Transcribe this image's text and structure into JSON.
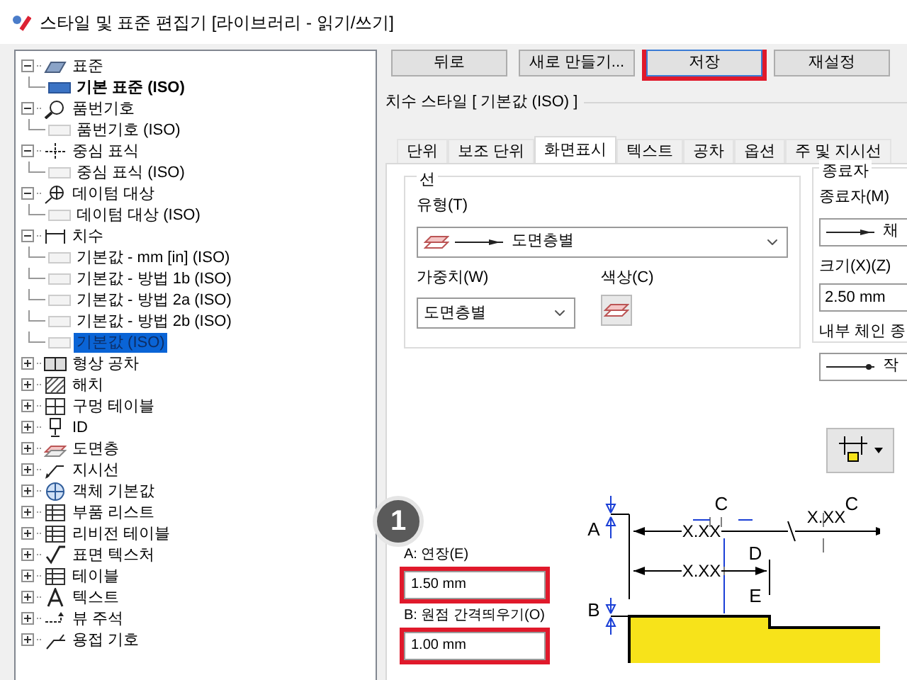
{
  "window": {
    "title": "스타일 및 표준 편집기 [라이브러리 - 읽기/쓰기]"
  },
  "tree": [
    {
      "label": "표준",
      "expanded": true,
      "children": [
        {
          "label": "기본 표준 (ISO)",
          "active": true,
          "selected": false
        }
      ]
    },
    {
      "label": "품번기호",
      "expanded": true,
      "children": [
        {
          "label": "품번기호 (ISO)",
          "active": false,
          "selected": false
        }
      ]
    },
    {
      "label": "중심 표식",
      "expanded": true,
      "children": [
        {
          "label": "중심 표식 (ISO)",
          "active": false,
          "selected": false
        }
      ]
    },
    {
      "label": "데이텀 대상",
      "expanded": true,
      "children": [
        {
          "label": "데이텀 대상 (ISO)",
          "active": false,
          "selected": false
        }
      ]
    },
    {
      "label": "치수",
      "expanded": true,
      "children": [
        {
          "label": "기본값 - mm [in] (ISO)",
          "active": false,
          "selected": false
        },
        {
          "label": "기본값 - 방법 1b (ISO)",
          "active": false,
          "selected": false
        },
        {
          "label": "기본값 - 방법 2a (ISO)",
          "active": false,
          "selected": false
        },
        {
          "label": "기본값 - 방법 2b (ISO)",
          "active": false,
          "selected": false
        },
        {
          "label": "기본값 (ISO)",
          "active": false,
          "selected": true
        }
      ]
    },
    {
      "label": "형상 공차",
      "expanded": false
    },
    {
      "label": "해치",
      "expanded": false
    },
    {
      "label": "구멍 테이블",
      "expanded": false
    },
    {
      "label": "ID",
      "expanded": false
    },
    {
      "label": "도면층",
      "expanded": false
    },
    {
      "label": "지시선",
      "expanded": false
    },
    {
      "label": "객체 기본값",
      "expanded": false
    },
    {
      "label": "부품 리스트",
      "expanded": false
    },
    {
      "label": "리비전 테이블",
      "expanded": false
    },
    {
      "label": "표면 텍스처",
      "expanded": false
    },
    {
      "label": "테이블",
      "expanded": false
    },
    {
      "label": "텍스트",
      "expanded": false
    },
    {
      "label": "뷰 주석",
      "expanded": false
    },
    {
      "label": "용접 기호",
      "expanded": false
    }
  ],
  "buttons": [
    {
      "label": "뒤로",
      "highlighted": false
    },
    {
      "label": "새로 만들기...",
      "highlighted": false
    },
    {
      "label": "저장",
      "highlighted": true
    },
    {
      "label": "재설정",
      "highlighted": false
    }
  ],
  "style_title": "치수 스타일 [ 기본값 (ISO) ]",
  "tabs": [
    {
      "label": "단위",
      "selected": false
    },
    {
      "label": "보조 단위",
      "selected": false
    },
    {
      "label": "화면표시",
      "selected": true
    },
    {
      "label": "텍스트",
      "selected": false
    },
    {
      "label": "공차",
      "selected": false
    },
    {
      "label": "옵션",
      "selected": false
    },
    {
      "label": "주 및 지시선",
      "selected": false
    }
  ],
  "line_group": {
    "title": "선",
    "type_label": "유형(T)",
    "type_value": "도면층별",
    "weight_label": "가중치(W)",
    "weight_value": "도면층별",
    "color_label": "색상(C)"
  },
  "terminator_group": {
    "title": "종료자",
    "terminator_label": "종료자(M)",
    "terminator_value": "채",
    "size_label": "크기(X)(Z)",
    "size_value": "2.50 mm",
    "inner_label": "내부 체인 종",
    "inner_value": "작"
  },
  "steps": [
    {
      "number": "1"
    }
  ],
  "fields": [
    {
      "label": "A: 연장(E)",
      "value": "1.50 mm",
      "highlighted": true
    },
    {
      "label": "B: 원점 간격띄우기(O)",
      "value": "1.00 mm",
      "highlighted": true
    }
  ],
  "diagram": {
    "labels": [
      "A",
      "B",
      "C",
      "C",
      "D",
      "E",
      "X.XX",
      "X.XX",
      "X.XX"
    ]
  }
}
